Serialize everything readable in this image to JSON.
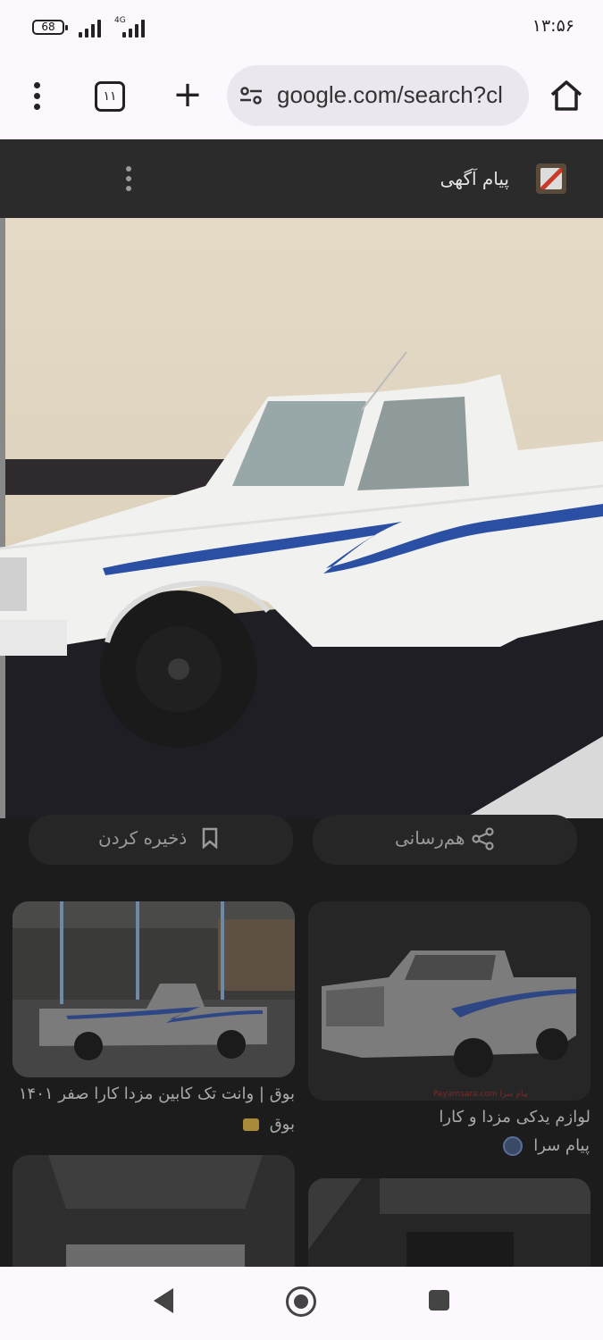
{
  "status_bar": {
    "battery": "68",
    "network": "4G",
    "time": "۱۳:۵۶"
  },
  "browser": {
    "tab_count": "۱۱",
    "url": "google.com/search?cl"
  },
  "viewer": {
    "source_name": "پیام آگهی",
    "share_label": "هم‌رسانی",
    "save_label": "ذخیره کردن"
  },
  "results": [
    {
      "title": "بوق | وانت تک کابین مزدا کارا صفر ۱۴۰۱",
      "source": "بوق"
    },
    {
      "title": "لوازم یدکی مزدا و کارا",
      "source": "پیام سرا",
      "watermark": "Payamsara.com پیام سرا"
    }
  ],
  "colors": {
    "system_bar_bg": "#fdf8fd",
    "url_bar_bg": "#ece6ee",
    "dim_overlay_bg": "#1c1c1c",
    "truck_stripe": "#2a4fa3"
  }
}
